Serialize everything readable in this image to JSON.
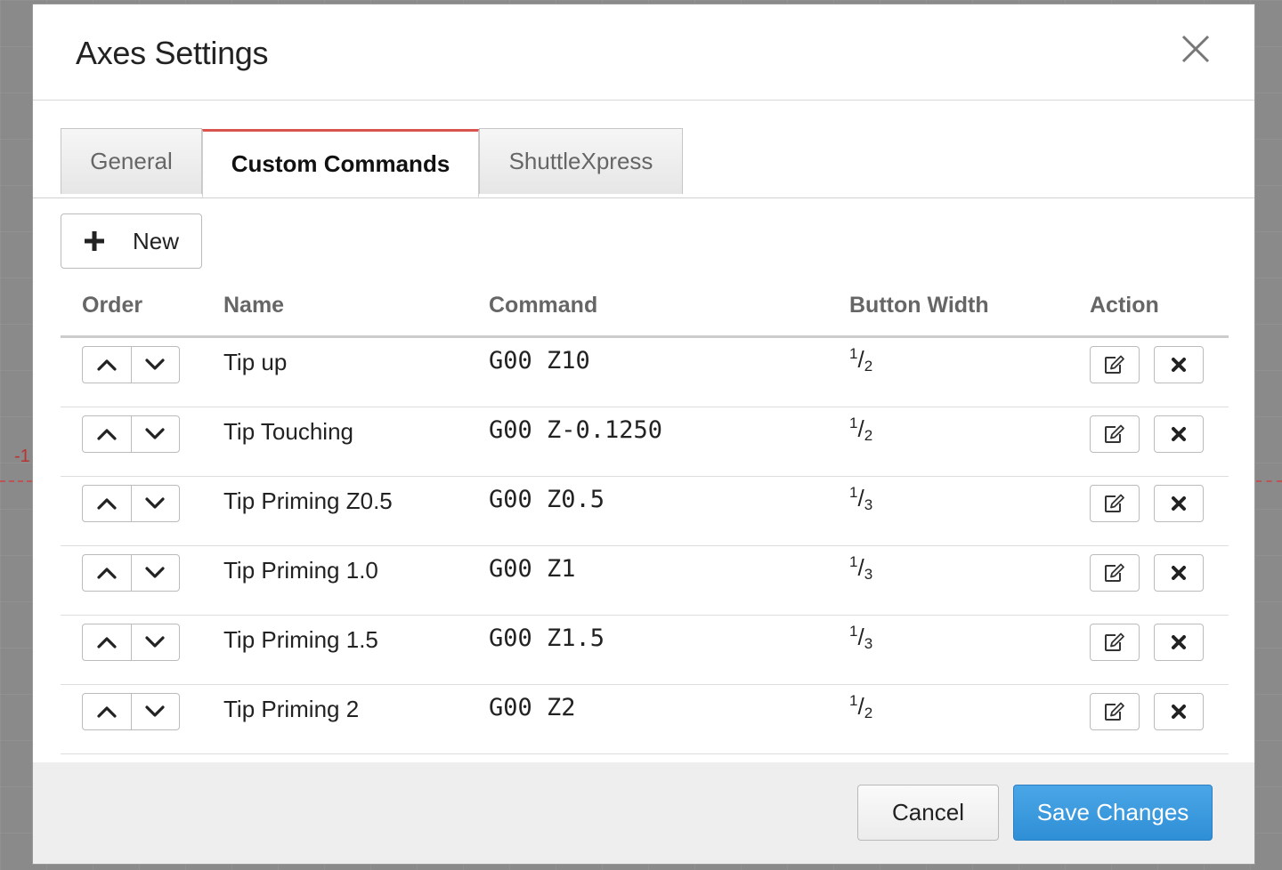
{
  "background": {
    "marker": "-1"
  },
  "dialog": {
    "title": "Axes Settings",
    "tabs": [
      {
        "label": "General",
        "active": false
      },
      {
        "label": "Custom Commands",
        "active": true
      },
      {
        "label": "ShuttleXpress",
        "active": false
      }
    ],
    "new_button_label": "New",
    "columns": [
      "Order",
      "Name",
      "Command",
      "Button Width",
      "Action"
    ],
    "rows": [
      {
        "name": "Tip up",
        "command": "G00 Z10",
        "width_num": "1",
        "width_den": "2"
      },
      {
        "name": "Tip Touching",
        "command": "G00 Z-0.1250",
        "width_num": "1",
        "width_den": "2"
      },
      {
        "name": "Tip Priming Z0.5",
        "command": "G00 Z0.5",
        "width_num": "1",
        "width_den": "3"
      },
      {
        "name": "Tip Priming 1.0",
        "command": "G00 Z1",
        "width_num": "1",
        "width_den": "3"
      },
      {
        "name": "Tip Priming 1.5",
        "command": "G00 Z1.5",
        "width_num": "1",
        "width_den": "3"
      },
      {
        "name": "Tip Priming 2",
        "command": "G00 Z2",
        "width_num": "1",
        "width_den": "2"
      }
    ],
    "footer": {
      "cancel_label": "Cancel",
      "save_label": "Save Changes"
    }
  },
  "colors": {
    "active_tab_accent": "#d9534f",
    "primary_button": "#3a9ae0"
  },
  "icons": {
    "close": "close-icon",
    "plus": "plus-icon",
    "up": "chevron-up-icon",
    "down": "chevron-down-icon",
    "edit": "edit-icon",
    "delete": "delete-icon"
  }
}
